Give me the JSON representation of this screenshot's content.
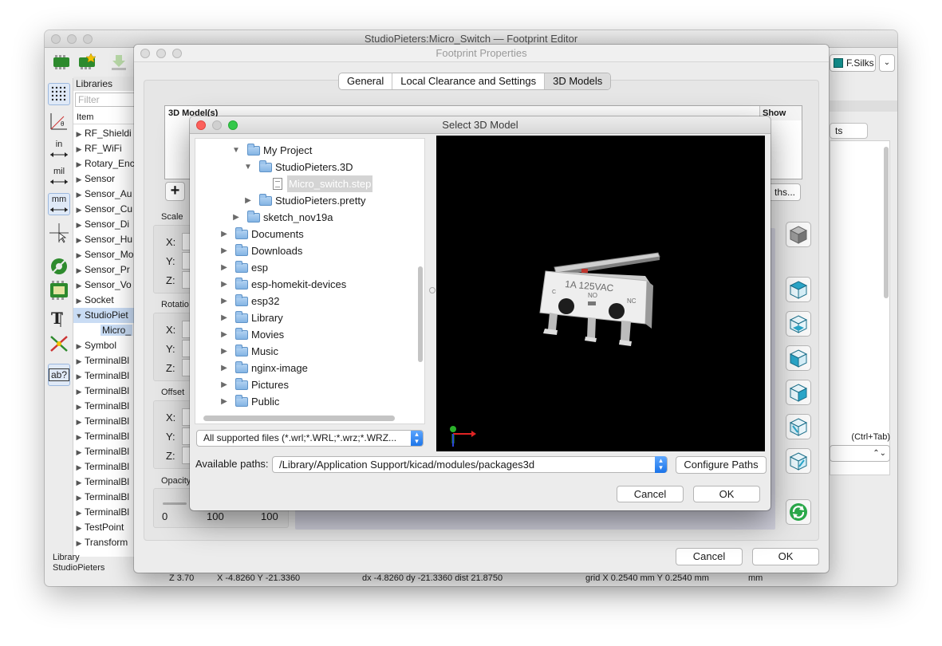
{
  "main_window": {
    "title": "StudioPieters:Micro_Switch — Footprint Editor",
    "layer": "F.Silks",
    "right_tab": "ts",
    "hotkey": "(Ctrl+Tab)",
    "library_panel": {
      "header": "Libraries",
      "filter_placeholder": "Filter",
      "column": "Item",
      "items": [
        {
          "label": "RF_Shieldi",
          "expanded": false
        },
        {
          "label": "RF_WiFi",
          "expanded": false
        },
        {
          "label": "Rotary_Enc",
          "expanded": false
        },
        {
          "label": "Sensor",
          "expanded": false
        },
        {
          "label": "Sensor_Au",
          "expanded": false
        },
        {
          "label": "Sensor_Cu",
          "expanded": false
        },
        {
          "label": "Sensor_Di",
          "expanded": false
        },
        {
          "label": "Sensor_Hu",
          "expanded": false
        },
        {
          "label": "Sensor_Mo",
          "expanded": false
        },
        {
          "label": "Sensor_Pr",
          "expanded": false
        },
        {
          "label": "Sensor_Vo",
          "expanded": false
        },
        {
          "label": "Socket",
          "expanded": false
        },
        {
          "label": "StudioPiet",
          "expanded": true
        },
        {
          "label": "Micro_",
          "child": true
        },
        {
          "label": "Symbol",
          "expanded": false
        },
        {
          "label": "TerminalBl",
          "expanded": false
        },
        {
          "label": "TerminalBl",
          "expanded": false
        },
        {
          "label": "TerminalBl",
          "expanded": false
        },
        {
          "label": "TerminalBl",
          "expanded": false
        },
        {
          "label": "TerminalBl",
          "expanded": false
        },
        {
          "label": "TerminalBl",
          "expanded": false
        },
        {
          "label": "TerminalBl",
          "expanded": false
        },
        {
          "label": "TerminalBl",
          "expanded": false
        },
        {
          "label": "TerminalBl",
          "expanded": false
        },
        {
          "label": "TerminalBl",
          "expanded": false
        },
        {
          "label": "TerminalBl",
          "expanded": false
        },
        {
          "label": "TestPoint",
          "expanded": false
        },
        {
          "label": "Transform",
          "expanded": false
        }
      ],
      "footer_line1": "Library",
      "footer_line2": "StudioPieters"
    },
    "left_tools": {
      "in": "in",
      "mil": "mil",
      "mm": "mm",
      "ab": "ab?"
    },
    "status": {
      "z": "Z 3.70",
      "xy": "X -4.8260  Y -21.3360",
      "delta": "dx -4.8260  dy -21.3360  dist 21.8750",
      "grid": "grid X 0.2540 mm  Y 0.2540 mm",
      "units": "mm"
    }
  },
  "footprint_properties": {
    "title": "Footprint Properties",
    "tabs": [
      "General",
      "Local Clearance and Settings",
      "3D Models"
    ],
    "active_tab": "3D Models",
    "table_header": "3D Model(s)",
    "show_header": "Show",
    "add_label": "+",
    "paths_button": "ths...",
    "scale_label": "Scale",
    "rotation_label": "Rotatio",
    "offset_label": "Offset",
    "opacity_label": "Opacity",
    "axis_x": "X:",
    "axis_y": "Y:",
    "axis_z": "Z:",
    "opacity_values": [
      "0",
      "100",
      "100"
    ],
    "cancel": "Cancel",
    "ok": "OK"
  },
  "select_model": {
    "title": "Select 3D Model",
    "tree": [
      {
        "label": "My Project",
        "level": 0,
        "arrow": "open",
        "type": "folder"
      },
      {
        "label": "StudioPieters.3D",
        "level": 1,
        "arrow": "open",
        "type": "folder"
      },
      {
        "label": "Micro_switch.step",
        "level": 2,
        "arrow": "none",
        "type": "file",
        "selected": true
      },
      {
        "label": "StudioPieters.pretty",
        "level": 1,
        "arrow": "closed",
        "type": "folder"
      },
      {
        "label": "sketch_nov19a",
        "level": 0,
        "arrow": "closed",
        "type": "folder"
      },
      {
        "label": "Documents",
        "level": -1,
        "arrow": "closed",
        "type": "folder"
      },
      {
        "label": "Downloads",
        "level": -1,
        "arrow": "closed",
        "type": "folder"
      },
      {
        "label": "esp",
        "level": -1,
        "arrow": "closed",
        "type": "folder"
      },
      {
        "label": "esp-homekit-devices",
        "level": -1,
        "arrow": "closed",
        "type": "folder"
      },
      {
        "label": "esp32",
        "level": -1,
        "arrow": "closed",
        "type": "folder"
      },
      {
        "label": "Library",
        "level": -1,
        "arrow": "closed",
        "type": "folder"
      },
      {
        "label": "Movies",
        "level": -1,
        "arrow": "closed",
        "type": "folder"
      },
      {
        "label": "Music",
        "level": -1,
        "arrow": "closed",
        "type": "folder"
      },
      {
        "label": "nginx-image",
        "level": -1,
        "arrow": "closed",
        "type": "folder"
      },
      {
        "label": "Pictures",
        "level": -1,
        "arrow": "closed",
        "type": "folder"
      },
      {
        "label": "Public",
        "level": -1,
        "arrow": "closed",
        "type": "folder"
      }
    ],
    "file_filter": "All supported files (*.wrl;*.WRL;*.wrz;*.WRZ...",
    "available_paths_label": "Available paths:",
    "available_path": "/Library/Application Support/kicad/modules/packages3d",
    "configure_paths": "Configure Paths",
    "cancel": "Cancel",
    "ok": "OK",
    "preview": {
      "rating": "1A 125VAC",
      "pin_c": "C",
      "pin_no": "NO",
      "pin_nc": "NC"
    }
  },
  "colors": {
    "accent": "#1a73e8",
    "viewport_bg": "#000000",
    "selection": "#c9dcf4",
    "layer_swatch": "#12908e"
  }
}
